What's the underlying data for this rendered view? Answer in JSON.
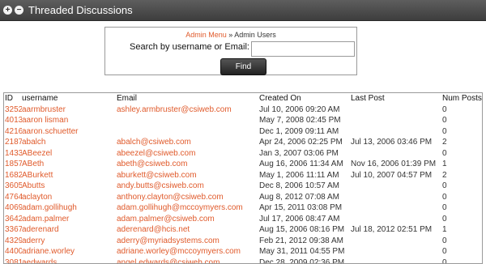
{
  "header": {
    "title": "Threaded Discussions",
    "icons": [
      "expand-icon",
      "collapse-icon"
    ]
  },
  "breadcrumb": {
    "admin_menu": "Admin Menu",
    "separator": "»",
    "current": "Admin Users"
  },
  "search": {
    "label": "Search by username or Email:",
    "value": "",
    "button": "Find"
  },
  "table": {
    "columns": [
      "ID",
      "username",
      "Email",
      "Created On",
      "Last Post",
      "Num Posts"
    ],
    "rows": [
      [
        "3252",
        "aarmbruster",
        "ashley.armbruster@csiweb.com",
        "Jul 10, 2006 09:20 AM",
        "",
        "0"
      ],
      [
        "4013",
        "aaron lisman",
        "",
        "May 7, 2008 02:45 PM",
        "",
        "0"
      ],
      [
        "4216",
        "aaron.schuetter",
        "",
        "Dec 1, 2009 09:11 AM",
        "",
        "0"
      ],
      [
        "2187",
        "abalch",
        "abalch@csiweb.com",
        "Apr 24, 2006 02:25 PM",
        "Jul 13, 2006 03:46 PM",
        "2"
      ],
      [
        "1433",
        "ABeezel",
        "abeezel@csiweb.com",
        "Jan 3, 2007 03:06 PM",
        "",
        "0"
      ],
      [
        "1857",
        "ABeth",
        "abeth@csiweb.com",
        "Aug 16, 2006 11:34 AM",
        "Nov 16, 2006 01:39 PM",
        "1"
      ],
      [
        "1682",
        "ABurkett",
        "aburkett@csiweb.com",
        "May 1, 2006 11:11 AM",
        "Jul 10, 2007 04:57 PM",
        "2"
      ],
      [
        "3605",
        "Abutts",
        "andy.butts@csiweb.com",
        "Dec 8, 2006 10:57 AM",
        "",
        "0"
      ],
      [
        "4764",
        "aclayton",
        "anthony.clayton@csiweb.com",
        "Aug 8, 2012 07:08 AM",
        "",
        "0"
      ],
      [
        "4069",
        "adam.gollihugh",
        "adam.gollihugh@mccoymyers.com",
        "Apr 15, 2011 03:08 PM",
        "",
        "0"
      ],
      [
        "3642",
        "adam.palmer",
        "adam.palmer@csiweb.com",
        "Jul 17, 2006 08:47 AM",
        "",
        "0"
      ],
      [
        "3367",
        "aderenard",
        "aderenard@hcis.net",
        "Aug 15, 2006 08:16 PM",
        "Jul 18, 2012 02:51 PM",
        "1"
      ],
      [
        "4329",
        "aderry",
        "aderry@myriadsystems.com",
        "Feb 21, 2012 09:38 AM",
        "",
        "0"
      ],
      [
        "4400",
        "adriane.worley",
        "adriane.worley@mccoymyers.com",
        "May 31, 2011 04:55 PM",
        "",
        "0"
      ],
      [
        "3081",
        "aedwards",
        "angel.edwards@csiweb.com",
        "Dec 28, 2009 02:36 PM",
        "",
        "0"
      ]
    ]
  }
}
